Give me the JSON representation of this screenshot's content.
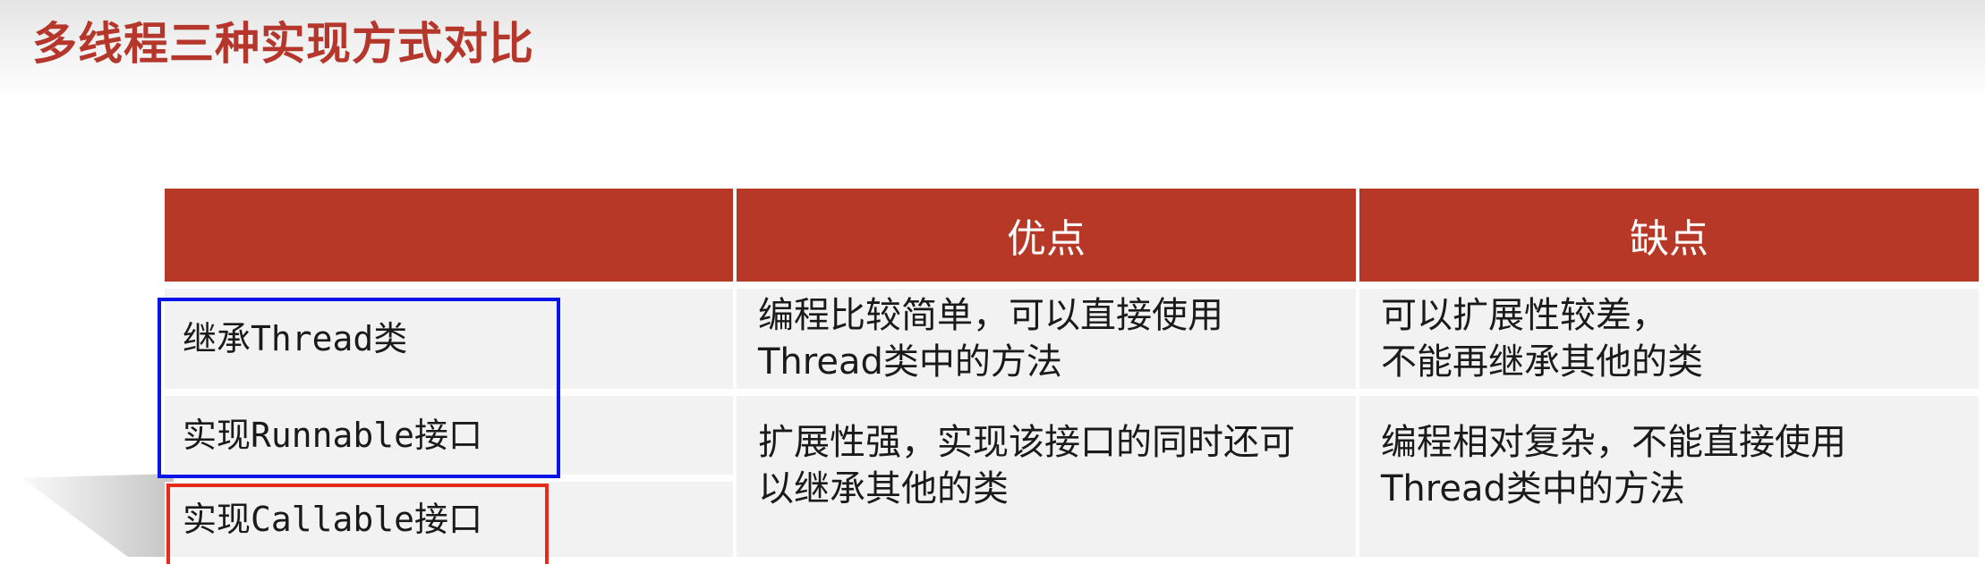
{
  "title": "多线程三种实现方式对比",
  "table": {
    "headers": [
      "",
      "优点",
      "缺点"
    ],
    "methods": [
      "继承Thread类",
      "实现Runnable接口",
      "实现Callable接口"
    ],
    "pros": [
      [
        "编程比较简单，可以直接使用",
        "Thread类中的方法"
      ],
      [
        "扩展性强，实现该接口的同时还可",
        "以继承其他的类"
      ]
    ],
    "cons": [
      [
        "可以扩展性较差，",
        "不能再继承其他的类"
      ],
      [
        "编程相对复杂，不能直接使用",
        "Thread类中的方法"
      ]
    ]
  },
  "colors": {
    "title": "#b5362a",
    "header_fill": "#b83827",
    "row_fill": "#f2f2f2",
    "highlight_blue": "#0a14e6",
    "highlight_red": "#e82a1a"
  }
}
